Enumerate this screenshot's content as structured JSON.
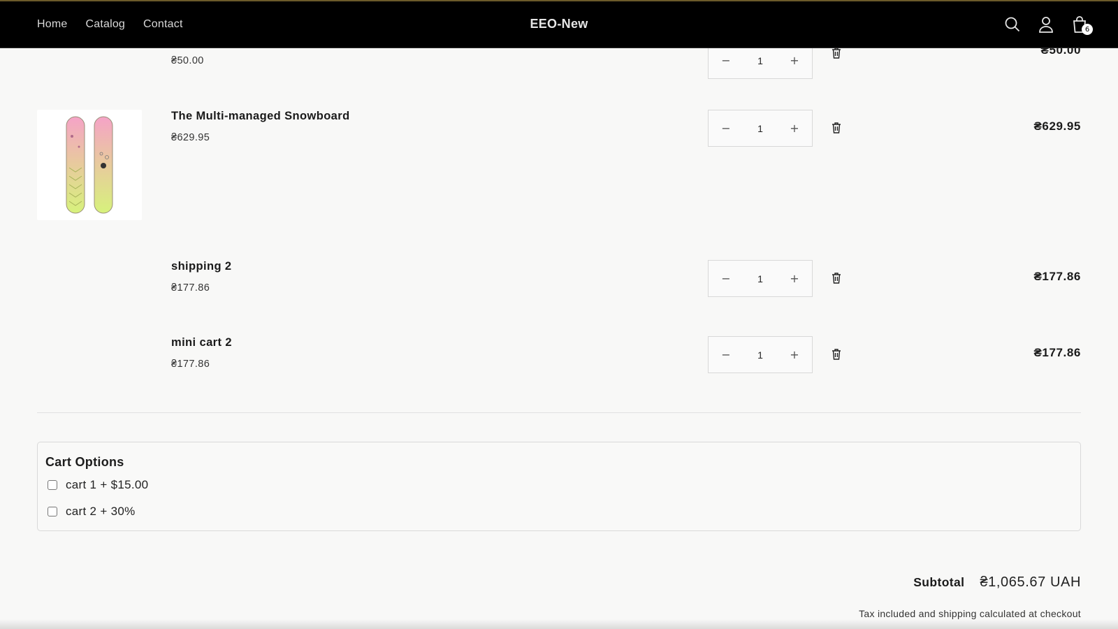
{
  "header": {
    "nav": [
      "Home",
      "Catalog",
      "Contact"
    ],
    "brand": "EEO-New",
    "cart_count": "6",
    "icons": [
      "search-icon",
      "account-icon",
      "cart-icon"
    ]
  },
  "items": [
    {
      "title": "",
      "price": "₴50.00",
      "quantity": "1",
      "total": "₴50.00",
      "has_image": false
    },
    {
      "title": "The Multi-managed Snowboard",
      "price": "₴629.95",
      "quantity": "1",
      "total": "₴629.95",
      "has_image": true
    },
    {
      "title": "shipping 2",
      "price": "₴177.86",
      "quantity": "1",
      "total": "₴177.86",
      "has_image": false
    },
    {
      "title": "mini cart 2",
      "price": "₴177.86",
      "quantity": "1",
      "total": "₴177.86",
      "has_image": false
    }
  ],
  "quantity_controls": {
    "decrease": "−",
    "increase": "+"
  },
  "cart_options": {
    "title": "Cart Options",
    "options": [
      {
        "label": "cart 1 + $15.00",
        "checked": false
      },
      {
        "label": "cart 2 + 30%",
        "checked": false
      }
    ]
  },
  "summary": {
    "subtotal_label": "Subtotal",
    "subtotal_value": "₴1,065.67 UAH",
    "tax_note": "Tax included and shipping calculated at checkout"
  },
  "colors": {
    "header_bg": "#000000",
    "page_bg": "#f8f8f7",
    "text": "#121212"
  }
}
